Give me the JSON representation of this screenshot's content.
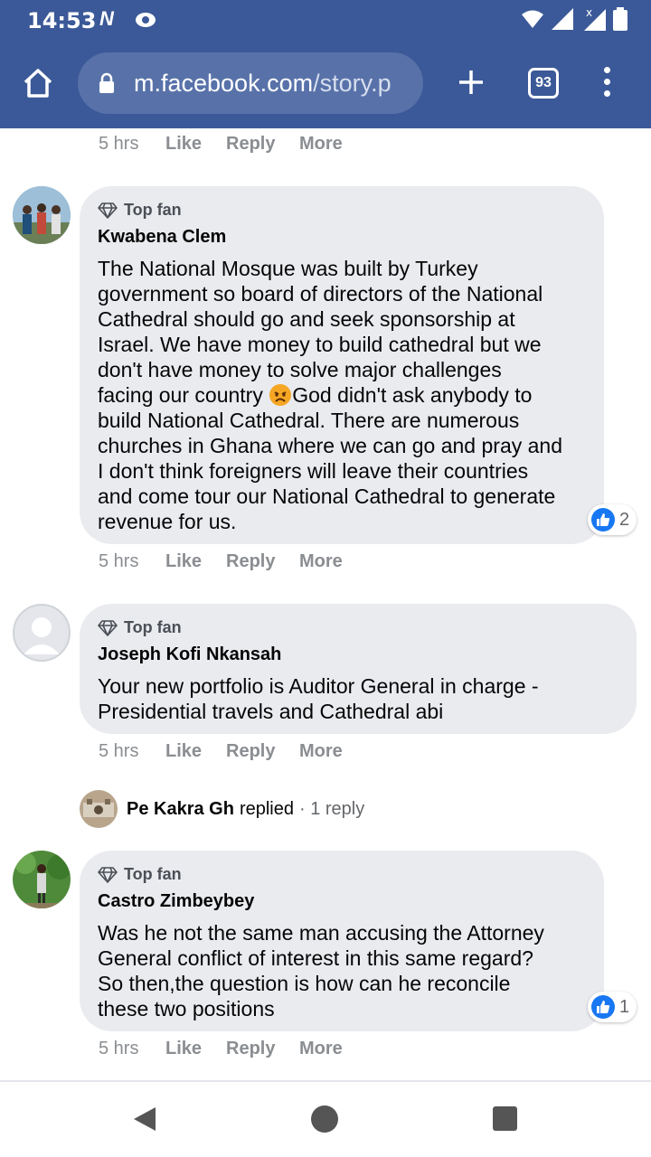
{
  "status_bar": {
    "time": "14:53",
    "n_label": "N"
  },
  "browser": {
    "url_host": "m.facebook.com",
    "url_path": "/story.p",
    "tab_count": "93"
  },
  "top_meta": {
    "time": "5 hrs",
    "like": "Like",
    "reply": "Reply",
    "more": "More"
  },
  "comments": [
    {
      "badge": "Top fan",
      "author": "Kwabena Clem",
      "lines": [
        "The National Mosque was built by Turkey",
        "government so board of directors of the National",
        "Cathedral should go and seek sponsorship at",
        "Israel. We have money to build cathedral but we",
        "don't have money to solve major challenges",
        "facing our country",
        "God didn't ask anybody to",
        "build National Cathedral. There are numerous",
        "churches in Ghana where we can go and pray and",
        "I don't think foreigners will leave their countries",
        "and come tour our National Cathedral to generate",
        "revenue for us."
      ],
      "reaction_count": "2",
      "meta": {
        "time": "5 hrs",
        "like": "Like",
        "reply": "Reply",
        "more": "More"
      }
    },
    {
      "badge": "Top fan",
      "author": "Joseph Kofi Nkansah",
      "lines": [
        "Your new portfolio is Auditor General in charge -",
        "Presidential travels and Cathedral abi"
      ],
      "meta": {
        "time": "5 hrs",
        "like": "Like",
        "reply": "Reply",
        "more": "More"
      },
      "replies": {
        "name": "Pe Kakra Gh",
        "text": "replied",
        "count": "· 1 reply"
      }
    },
    {
      "badge": "Top fan",
      "author": "Castro Zimbeybey",
      "lines": [
        "Was he not the same man accusing the Attorney",
        "General conflict of interest in this same regard?",
        "So then,the question is how can he reconcile",
        "these two positions"
      ],
      "reaction_count": "1",
      "meta": {
        "time": "5 hrs",
        "like": "Like",
        "reply": "Reply",
        "more": "More"
      }
    }
  ],
  "colors": {
    "chrome": "#3b5998",
    "bubble": "#eaebef",
    "like_blue": "#1877f2"
  }
}
